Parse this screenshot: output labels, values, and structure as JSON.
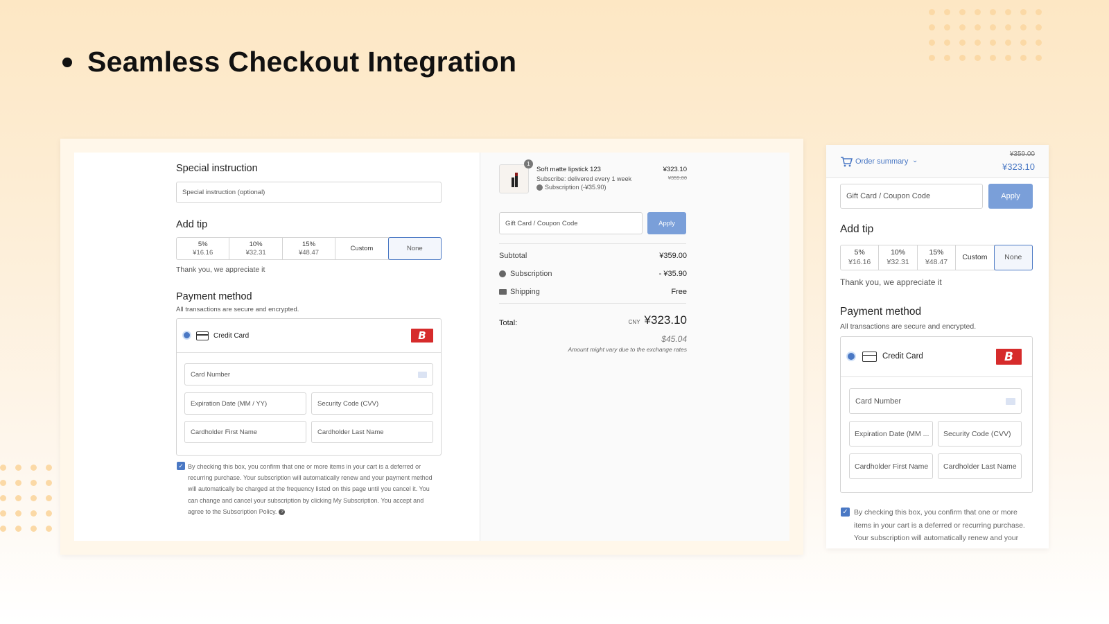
{
  "slide": {
    "title": "Seamless Checkout Integration"
  },
  "desktop": {
    "special_instruction": {
      "title": "Special instruction",
      "placeholder": "Special instruction (optional)"
    },
    "tip": {
      "title": "Add tip",
      "options": [
        {
          "label": "5%",
          "amount": "¥16.16"
        },
        {
          "label": "10%",
          "amount": "¥32.31"
        },
        {
          "label": "15%",
          "amount": "¥48.47"
        },
        {
          "label": "Custom"
        },
        {
          "label": "None"
        }
      ],
      "thanks": "Thank you, we appreciate it"
    },
    "payment": {
      "title": "Payment method",
      "subtitle": "All transactions are secure and encrypted.",
      "method_label": "Credit Card",
      "brand_letter": "B",
      "card_number": "Card Number",
      "expiration": "Expiration Date (MM / YY)",
      "cvv": "Security Code (CVV)",
      "first_name": "Cardholder First Name",
      "last_name": "Cardholder Last Name"
    },
    "consent": {
      "lines": [
        "By checking this box, you confirm that one or more items in your cart is a deferred or",
        "recurring purchase. Your subscription will automatically renew and your payment method",
        "will automatically be charged at the frequency listed on this page until you cancel it. You",
        "can change and cancel your subscription by clicking My Subscription. You accept and",
        "agree to the Subscription Policy."
      ],
      "help": "?"
    },
    "summary": {
      "product": {
        "name": "Soft matte lipstick 123",
        "quantity": "1",
        "subscribe": "Subscribe:  delivered every 1 week",
        "subscription_note": "Subscription (-¥35.90)",
        "price": "¥323.10",
        "original_price": "¥359.00"
      },
      "coupon_placeholder": "Gift Card / Coupon Code",
      "apply_label": "Apply",
      "rows": [
        {
          "label": "Subtotal",
          "value": "¥359.00"
        },
        {
          "label": "Subscription",
          "value": "- ¥35.90"
        },
        {
          "label": "Shipping",
          "value": "Free"
        }
      ],
      "total_label": "Total:",
      "currency": "CNY",
      "total": "¥323.10",
      "usd": "$45.04",
      "exchange_note": "Amount might vary due to the exchange rates"
    }
  },
  "mobile": {
    "order_summary_label": "Order summary",
    "original_price": "¥359.00",
    "price": "¥323.10",
    "coupon_placeholder": "Gift Card / Coupon Code",
    "apply_label": "Apply",
    "tip_title": "Add tip",
    "tip_options": [
      {
        "label": "5%",
        "amount": "¥16.16"
      },
      {
        "label": "10%",
        "amount": "¥32.31"
      },
      {
        "label": "15%",
        "amount": "¥48.47"
      },
      {
        "label": "Custom"
      },
      {
        "label": "None"
      }
    ],
    "thanks": "Thank you, we appreciate it",
    "payment_title": "Payment method",
    "payment_subtitle": "All transactions are secure and encrypted.",
    "method_label": "Credit Card",
    "brand_letter": "B",
    "card_number": "Card Number",
    "expiration": "Expiration Date (MM ...",
    "cvv": "Security Code (CVV)",
    "first_name": "Cardholder First Name",
    "last_name": "Cardholder Last Name",
    "consent_lines": [
      "By checking this box, you confirm that one or more",
      "items in your cart is a deferred or recurring purchase.",
      "Your subscription will automatically renew and your"
    ]
  },
  "colors": {
    "accent": "#4a78c4",
    "apply": "#7a9fd9",
    "brand": "#d62b2b",
    "dots": "#fbd9a6"
  }
}
